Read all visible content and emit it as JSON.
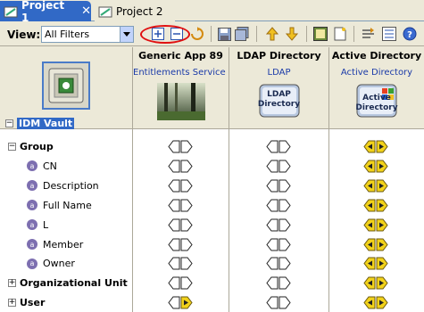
{
  "tabs": [
    {
      "label": "Project 1",
      "active": true,
      "close": "✕"
    },
    {
      "label": "Project 2",
      "active": false
    }
  ],
  "toolbar": {
    "view_label": "View:",
    "view_value": "All Filters"
  },
  "vault": {
    "label": "IDM Vault",
    "expanded": "−"
  },
  "connectors": [
    {
      "name": "Generic App 89",
      "subtitle": "Entitlements Service D...",
      "image": "forest-photo"
    },
    {
      "name": "LDAP Directory",
      "subtitle": "LDAP",
      "image": "ldap-directory-icon",
      "image_text": [
        "LDAP",
        "Directory"
      ]
    },
    {
      "name": "Active Directory",
      "subtitle": "Active Directory",
      "image": "active-directory-icon",
      "image_text": [
        "Active",
        "Directory"
      ]
    }
  ],
  "rows": [
    {
      "label": "Group",
      "type": "class",
      "expander": "−",
      "states": [
        "none",
        "none",
        "both"
      ]
    },
    {
      "label": "CN",
      "type": "attr",
      "states": [
        "none",
        "none",
        "both"
      ]
    },
    {
      "label": "Description",
      "type": "attr",
      "states": [
        "none",
        "none",
        "both"
      ]
    },
    {
      "label": "Full Name",
      "type": "attr",
      "states": [
        "none",
        "none",
        "both"
      ]
    },
    {
      "label": "L",
      "type": "attr",
      "states": [
        "none",
        "none",
        "both"
      ]
    },
    {
      "label": "Member",
      "type": "attr",
      "states": [
        "none",
        "none",
        "both"
      ]
    },
    {
      "label": "Owner",
      "type": "attr",
      "states": [
        "none",
        "none",
        "both"
      ]
    },
    {
      "label": "Organizational Unit",
      "type": "class",
      "expander": "+",
      "states": [
        "none",
        "none",
        "both"
      ]
    },
    {
      "label": "User",
      "type": "class",
      "expander": "+",
      "states": [
        "right",
        "none",
        "both"
      ]
    }
  ],
  "attr_badge": "a",
  "colors": {
    "active_tab": "#3169c6",
    "flow_active": "#f2d21a",
    "flow_border": "#6b5a10",
    "highlight": "#e01010"
  }
}
